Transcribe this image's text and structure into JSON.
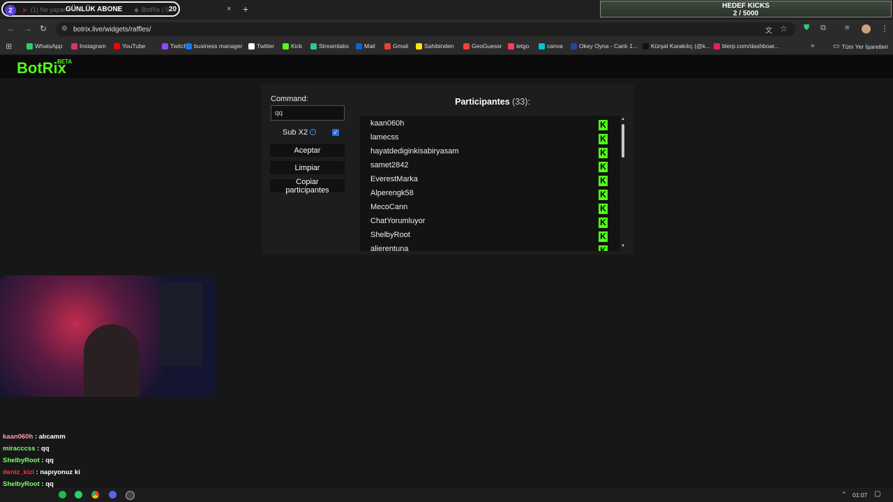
{
  "browser": {
    "tabs": [
      {
        "label": "(1) Ne yapan"
      },
      {
        "label": "BotRix | S"
      }
    ],
    "new_tab": "+",
    "url": "botrix.live/widgets/raffles/",
    "bookmarks": [
      {
        "label": "WhatsApp",
        "color": "#25d366"
      },
      {
        "label": "Instagram",
        "color": "#e1306c"
      },
      {
        "label": "YouTube",
        "color": "#ff0000"
      },
      {
        "label": "Twitch",
        "color": "#9146ff"
      },
      {
        "label": "business manager",
        "color": "#1877f2"
      },
      {
        "label": "Twitter",
        "color": "#ffffff"
      },
      {
        "label": "Kick",
        "color": "#53fc18"
      },
      {
        "label": "Streamlabs",
        "color": "#31c3a2"
      },
      {
        "label": "Mail",
        "color": "#0a64d6"
      },
      {
        "label": "Gmail",
        "color": "#ea4335"
      },
      {
        "label": "Sahibinden",
        "color": "#ffe800"
      },
      {
        "label": "GeoGuessr",
        "color": "#ff3d3d"
      },
      {
        "label": "letgo",
        "color": "#ff3f55"
      },
      {
        "label": "canva",
        "color": "#00c4cc"
      },
      {
        "label": "Okey Oyna - Canlı 1...",
        "color": "#2244aa"
      },
      {
        "label": "Kürşat Karakılıç (@k...",
        "color": "#111111"
      },
      {
        "label": "blerp.com/dashboar...",
        "color": "#e0245e"
      }
    ],
    "bookmarks_overflow": "»",
    "all_bookmarks": "Tüm Yer İşaretleri"
  },
  "overlay": {
    "abone_number": "2",
    "abone_label": "GÜNLÜK ABONE",
    "abone_count": "20",
    "goal_title": "HEDEF KICKS",
    "goal_value": "2 / 5000"
  },
  "page": {
    "logo": "BotRix",
    "logo_badge": "BETA"
  },
  "raffle": {
    "command_label": "Command:",
    "command_value": "qq",
    "sub_label": "Sub X2",
    "sub_checked": true,
    "buttons": {
      "accept": "Aceptar",
      "clear": "Limpiar",
      "copy": "Copiar participantes"
    },
    "participants_title": "Participantes",
    "participants_count": "(33):",
    "participants": [
      "kaan060h",
      "lamecss",
      "hayatdediginkisabiryasam",
      "samet2842",
      "EverestMarka",
      "Alperengk58",
      "MecoCann",
      "ChatYorumluyor",
      "ShelbyRoot",
      "alierentuna"
    ]
  },
  "chat": [
    {
      "user": "kaan060h",
      "msg": ": alıcamm",
      "color": "#ff9eb0"
    },
    {
      "user": "miracccss",
      "msg": ": qq",
      "color": "#7dff6a"
    },
    {
      "user": "ShelbyRoot",
      "msg": ": qq",
      "color": "#7dff6a"
    },
    {
      "user": "deniz_kizi",
      "msg": ": napıyonuz ki",
      "color": "#ff3333"
    },
    {
      "user": "ShelbyRoot",
      "msg": ": qq",
      "color": "#7dff6a"
    },
    {
      "user": "ShelbyRoot",
      "msg": ": qq",
      "color": "#7dff6a"
    }
  ],
  "taskbar": {
    "clock": "01:07"
  }
}
